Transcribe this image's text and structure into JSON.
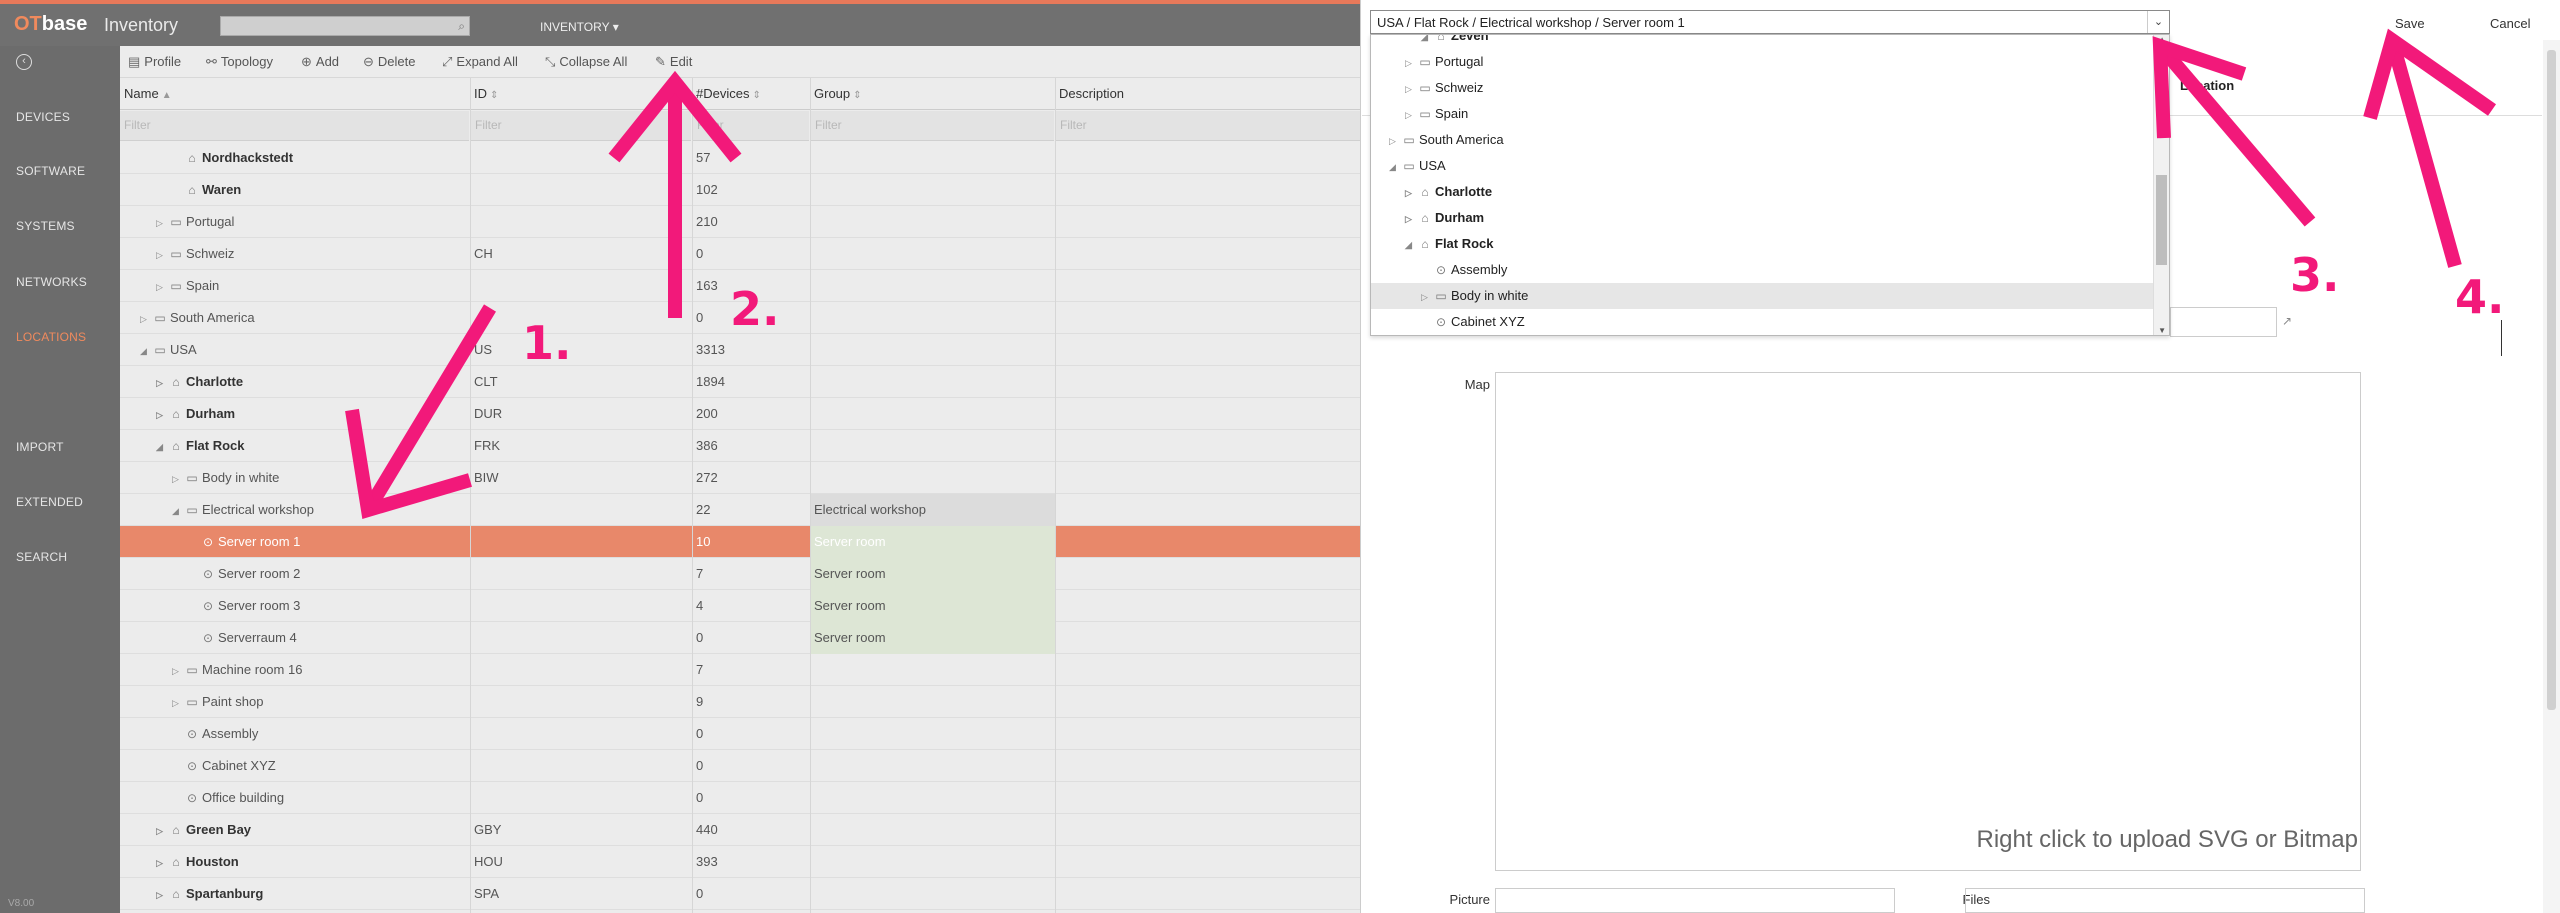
{
  "app": {
    "logo_ot": "OT",
    "logo_base": "base",
    "title": "Inventory",
    "module": "INVENTORY ▾"
  },
  "nav": {
    "items": [
      {
        "label": "DEVICES",
        "active": false
      },
      {
        "label": "SOFTWARE",
        "active": false
      },
      {
        "label": "SYSTEMS",
        "active": false
      },
      {
        "label": "NETWORKS",
        "active": false
      },
      {
        "label": "LOCATIONS",
        "active": true
      },
      {
        "label": "IMPORT",
        "active": false
      },
      {
        "label": "EXTENDED",
        "active": false
      },
      {
        "label": "SEARCH",
        "active": false
      }
    ],
    "version": "V8.00"
  },
  "toolbar": {
    "profile": "Profile",
    "topology": "Topology",
    "add": "Add",
    "delete": "Delete",
    "expand_all": "Expand All",
    "collapse_all": "Collapse All",
    "edit": "Edit"
  },
  "table": {
    "headers": {
      "name": "Name",
      "id": "ID",
      "devices": "#Devices",
      "group": "Group",
      "description": "Description"
    },
    "filter_placeholder": "Filter",
    "rows": [
      {
        "indent": 3,
        "exp": "",
        "icon": "home",
        "name": "Nordhackstedt",
        "id": "",
        "devices": "57",
        "group": "",
        "bold": true,
        "selected": false
      },
      {
        "indent": 3,
        "exp": "",
        "icon": "home",
        "name": "Waren",
        "id": "",
        "devices": "102",
        "group": "",
        "bold": true,
        "selected": false
      },
      {
        "indent": 2,
        "exp": "▷",
        "icon": "folder",
        "name": "Portugal",
        "id": "",
        "devices": "210",
        "group": "",
        "bold": false,
        "selected": false
      },
      {
        "indent": 2,
        "exp": "▷",
        "icon": "folder",
        "name": "Schweiz",
        "id": "CH",
        "devices": "0",
        "group": "",
        "bold": false,
        "selected": false
      },
      {
        "indent": 2,
        "exp": "▷",
        "icon": "folder",
        "name": "Spain",
        "id": "",
        "devices": "163",
        "group": "",
        "bold": false,
        "selected": false
      },
      {
        "indent": 1,
        "exp": "▷",
        "icon": "folder",
        "name": "South America",
        "id": "",
        "devices": "0",
        "group": "",
        "bold": false,
        "selected": false
      },
      {
        "indent": 1,
        "exp": "◢",
        "icon": "folder",
        "name": "USA",
        "id": "US",
        "devices": "3313",
        "group": "",
        "bold": false,
        "selected": false
      },
      {
        "indent": 2,
        "exp": "▷",
        "icon": "home",
        "name": "Charlotte",
        "id": "CLT",
        "devices": "1894",
        "group": "",
        "bold": true,
        "selected": false
      },
      {
        "indent": 2,
        "exp": "▷",
        "icon": "home",
        "name": "Durham",
        "id": "DUR",
        "devices": "200",
        "group": "",
        "bold": true,
        "selected": false
      },
      {
        "indent": 2,
        "exp": "◢",
        "icon": "home",
        "name": "Flat Rock",
        "id": "FRK",
        "devices": "386",
        "group": "",
        "bold": true,
        "selected": false
      },
      {
        "indent": 3,
        "exp": "▷",
        "icon": "folder",
        "name": "Body in white",
        "id": "BIW",
        "devices": "272",
        "group": "",
        "bold": false,
        "selected": false
      },
      {
        "indent": 3,
        "exp": "◢",
        "icon": "folder",
        "name": "Electrical workshop",
        "id": "",
        "devices": "22",
        "group": "Electrical workshop",
        "group_style": "head",
        "bold": false,
        "selected": false
      },
      {
        "indent": 4,
        "exp": "",
        "icon": "pin",
        "name": "Server room 1",
        "id": "",
        "devices": "10",
        "group": "Server room",
        "group_style": "green",
        "bold": false,
        "selected": true
      },
      {
        "indent": 4,
        "exp": "",
        "icon": "pin",
        "name": "Server room 2",
        "id": "",
        "devices": "7",
        "group": "Server room",
        "group_style": "green",
        "bold": false,
        "selected": false
      },
      {
        "indent": 4,
        "exp": "",
        "icon": "pin",
        "name": "Server room 3",
        "id": "",
        "devices": "4",
        "group": "Server room",
        "group_style": "green",
        "bold": false,
        "selected": false
      },
      {
        "indent": 4,
        "exp": "",
        "icon": "pin",
        "name": "Serverraum 4",
        "id": "",
        "devices": "0",
        "group": "Server room",
        "group_style": "green",
        "bold": false,
        "selected": false
      },
      {
        "indent": 3,
        "exp": "▷",
        "icon": "folder",
        "name": "Machine room 16",
        "id": "",
        "devices": "7",
        "group": "",
        "bold": false,
        "selected": false
      },
      {
        "indent": 3,
        "exp": "▷",
        "icon": "folder",
        "name": "Paint shop",
        "id": "",
        "devices": "9",
        "group": "",
        "bold": false,
        "selected": false
      },
      {
        "indent": 3,
        "exp": "",
        "icon": "pin",
        "name": "Assembly",
        "id": "",
        "devices": "0",
        "group": "",
        "bold": false,
        "selected": false
      },
      {
        "indent": 3,
        "exp": "",
        "icon": "pin",
        "name": "Cabinet XYZ",
        "id": "",
        "devices": "0",
        "group": "",
        "bold": false,
        "selected": false
      },
      {
        "indent": 3,
        "exp": "",
        "icon": "pin",
        "name": "Office building",
        "id": "",
        "devices": "0",
        "group": "",
        "bold": false,
        "selected": false
      },
      {
        "indent": 2,
        "exp": "▷",
        "icon": "home",
        "name": "Green Bay",
        "id": "GBY",
        "devices": "440",
        "group": "",
        "bold": true,
        "selected": false
      },
      {
        "indent": 2,
        "exp": "▷",
        "icon": "home",
        "name": "Houston",
        "id": "HOU",
        "devices": "393",
        "group": "",
        "bold": true,
        "selected": false
      },
      {
        "indent": 2,
        "exp": "▷",
        "icon": "home",
        "name": "Spartanburg",
        "id": "SPA",
        "devices": "0",
        "group": "",
        "bold": true,
        "selected": false
      }
    ]
  },
  "editor": {
    "path_value": "USA / Flat Rock / Electrical workshop / Server room 1",
    "save": "Save",
    "cancel": "Cancel",
    "tab_location": "Location",
    "map_label": "Map",
    "map_hint": "Right click to upload SVG or Bitmap",
    "picture_label": "Picture",
    "files_label": "Files",
    "dropdown_items": [
      {
        "indent": 3,
        "exp": "◢",
        "icon": "home",
        "name": "Zeven",
        "bold": true,
        "hover": false,
        "partial": true
      },
      {
        "indent": 2,
        "exp": "▷",
        "icon": "folder",
        "name": "Portugal",
        "bold": false,
        "hover": false
      },
      {
        "indent": 2,
        "exp": "▷",
        "icon": "folder",
        "name": "Schweiz",
        "bold": false,
        "hover": false
      },
      {
        "indent": 2,
        "exp": "▷",
        "icon": "folder",
        "name": "Spain",
        "bold": false,
        "hover": false
      },
      {
        "indent": 1,
        "exp": "▷",
        "icon": "folder",
        "name": "South America",
        "bold": false,
        "hover": false
      },
      {
        "indent": 1,
        "exp": "◢",
        "icon": "folder",
        "name": "USA",
        "bold": false,
        "hover": false
      },
      {
        "indent": 2,
        "exp": "▷",
        "icon": "home",
        "name": "Charlotte",
        "bold": true,
        "hover": false
      },
      {
        "indent": 2,
        "exp": "▷",
        "icon": "home",
        "name": "Durham",
        "bold": true,
        "hover": false
      },
      {
        "indent": 2,
        "exp": "◢",
        "icon": "home",
        "name": "Flat Rock",
        "bold": true,
        "hover": false
      },
      {
        "indent": 3,
        "exp": "",
        "icon": "pin",
        "name": "Assembly",
        "bold": false,
        "hover": false
      },
      {
        "indent": 3,
        "exp": "▷",
        "icon": "folder",
        "name": "Body in white",
        "bold": false,
        "hover": true
      },
      {
        "indent": 3,
        "exp": "",
        "icon": "pin",
        "name": "Cabinet XYZ",
        "bold": false,
        "hover": false
      }
    ]
  },
  "annotations": {
    "labels": [
      "1.",
      "2.",
      "3.",
      "4."
    ],
    "color": "#f2197a"
  },
  "colors": {
    "accent": "#e8795a",
    "selected_row": "#e8886a",
    "group_green": "#dde6d5",
    "nav_bg": "#6c6c6c"
  }
}
